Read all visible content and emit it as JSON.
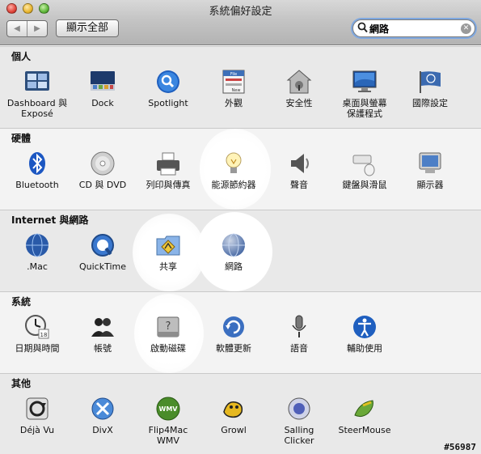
{
  "window": {
    "title": "系統偏好設定"
  },
  "toolbar": {
    "back_glyph": "◀",
    "forward_glyph": "▶",
    "show_all_label": "顯示全部",
    "search_value": "網路",
    "search_icon": "magnifier-icon",
    "clear_icon": "clear-search-icon"
  },
  "highlights": [
    "能源節約器",
    "共享",
    "網路",
    "啟動磁碟"
  ],
  "sections": {
    "personal": {
      "title": "個人",
      "items": [
        {
          "label": "Dashboard 與\nExposé",
          "icon": "dashboard-expose-icon"
        },
        {
          "label": "Dock",
          "icon": "dock-icon"
        },
        {
          "label": "Spotlight",
          "icon": "spotlight-icon"
        },
        {
          "label": "外觀",
          "icon": "appearance-icon"
        },
        {
          "label": "安全性",
          "icon": "security-house-icon"
        },
        {
          "label": "桌面與螢幕\n保護程式",
          "icon": "desktop-screensaver-icon"
        },
        {
          "label": "國際設定",
          "icon": "international-flag-icon"
        }
      ]
    },
    "hardware": {
      "title": "硬體",
      "items": [
        {
          "label": "Bluetooth",
          "icon": "bluetooth-icon"
        },
        {
          "label": "CD 與 DVD",
          "icon": "cd-dvd-icon"
        },
        {
          "label": "列印與傳真",
          "icon": "printer-icon"
        },
        {
          "label": "能源節約器",
          "icon": "energy-saver-bulb-icon"
        },
        {
          "label": "聲音",
          "icon": "speaker-icon"
        },
        {
          "label": "鍵盤與滑鼠",
          "icon": "keyboard-mouse-icon"
        },
        {
          "label": "顯示器",
          "icon": "display-icon"
        }
      ]
    },
    "internet": {
      "title": "Internet 與網路",
      "items": [
        {
          "label": ".Mac",
          "icon": "dotmac-globe-icon"
        },
        {
          "label": "QuickTime",
          "icon": "quicktime-icon"
        },
        {
          "label": "共享",
          "icon": "sharing-folder-icon"
        },
        {
          "label": "網路",
          "icon": "network-globe-icon"
        }
      ]
    },
    "system": {
      "title": "系統",
      "items": [
        {
          "label": "日期與時間",
          "icon": "date-time-clock-icon"
        },
        {
          "label": "帳號",
          "icon": "accounts-people-icon"
        },
        {
          "label": "啟動磁碟",
          "icon": "startup-disk-icon"
        },
        {
          "label": "軟體更新",
          "icon": "software-update-icon"
        },
        {
          "label": "語音",
          "icon": "speech-microphone-icon"
        },
        {
          "label": "輔助使用",
          "icon": "universal-access-icon"
        }
      ]
    },
    "other": {
      "title": "其他",
      "items": [
        {
          "label": "Déjà Vu",
          "icon": "deja-vu-icon"
        },
        {
          "label": "DivX",
          "icon": "divx-icon"
        },
        {
          "label": "Flip4Mac\nWMV",
          "icon": "flip4mac-wmv-icon"
        },
        {
          "label": "Growl",
          "icon": "growl-icon"
        },
        {
          "label": "Salling\nClicker",
          "icon": "salling-clicker-icon"
        },
        {
          "label": "SteerMouse",
          "icon": "steermouse-icon"
        }
      ]
    }
  },
  "watermark": "#56987"
}
